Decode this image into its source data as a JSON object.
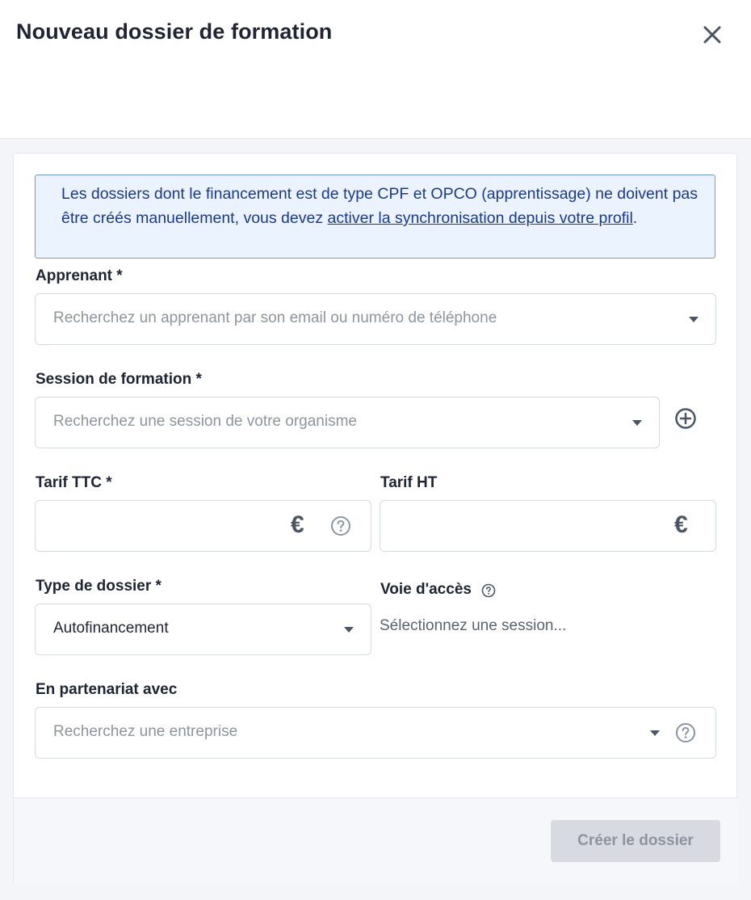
{
  "modal": {
    "title": "Nouveau dossier de formation"
  },
  "alert": {
    "text_before": "Les dossiers dont le financement est de type CPF et OPCO (apprentissage) ne doivent pas être créés manuellement, vous devez ",
    "link_text": "activer la synchronisation depuis votre profil",
    "text_after": "."
  },
  "apprenant": {
    "label": "Apprenant *",
    "placeholder": "Recherchez un apprenant par son email ou numéro de téléphone"
  },
  "session": {
    "label": "Session de formation *",
    "placeholder": "Recherchez une session de votre organisme"
  },
  "tarif_ttc": {
    "label": "Tarif TTC *",
    "value": "",
    "currency": "€"
  },
  "tarif_ht": {
    "label": "Tarif HT",
    "value": "",
    "currency": "€"
  },
  "type_dossier": {
    "label": "Type de dossier *",
    "selected": "Autofinancement"
  },
  "voie_acces": {
    "label": "Voie d'accès",
    "hint": "Sélectionnez une session..."
  },
  "partenariat": {
    "label": "En partenariat avec",
    "placeholder": "Recherchez une entreprise"
  },
  "footer": {
    "create_label": "Créer le dossier"
  },
  "colors": {
    "alert_bg": "#eaf3ff",
    "alert_border": "#6e99e6",
    "alert_text": "#1b3a8c",
    "disabled_button": "#d7dbe1"
  }
}
